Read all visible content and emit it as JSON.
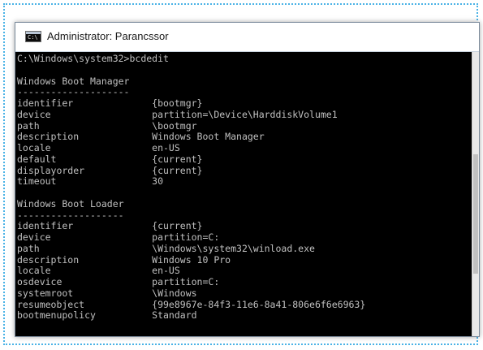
{
  "window": {
    "title": "Administrator: Parancssor",
    "icon": "cmd-console-icon",
    "icon_text": "C:\\",
    "border_color": "#7b8a9b",
    "frame_color": "#49b2e6"
  },
  "console": {
    "foreground": "#c0c0c0",
    "background": "#000000",
    "lines": [
      "C:\\Windows\\system32>bcdedit",
      "",
      "Windows Boot Manager",
      "--------------------",
      "identifier              {bootmgr}",
      "device                  partition=\\Device\\HarddiskVolume1",
      "path                    \\bootmgr",
      "description             Windows Boot Manager",
      "locale                  en-US",
      "default                 {current}",
      "displayorder            {current}",
      "timeout                 30",
      "",
      "Windows Boot Loader",
      "-------------------",
      "identifier              {current}",
      "device                  partition=C:",
      "path                    \\Windows\\system32\\winload.exe",
      "description             Windows 10 Pro",
      "locale                  en-US",
      "osdevice                partition=C:",
      "systemroot              \\Windows",
      "resumeobject            {99e8967e-84f3-11e6-8a41-806e6f6e6963}",
      "bootmenupolicy          Standard"
    ]
  }
}
